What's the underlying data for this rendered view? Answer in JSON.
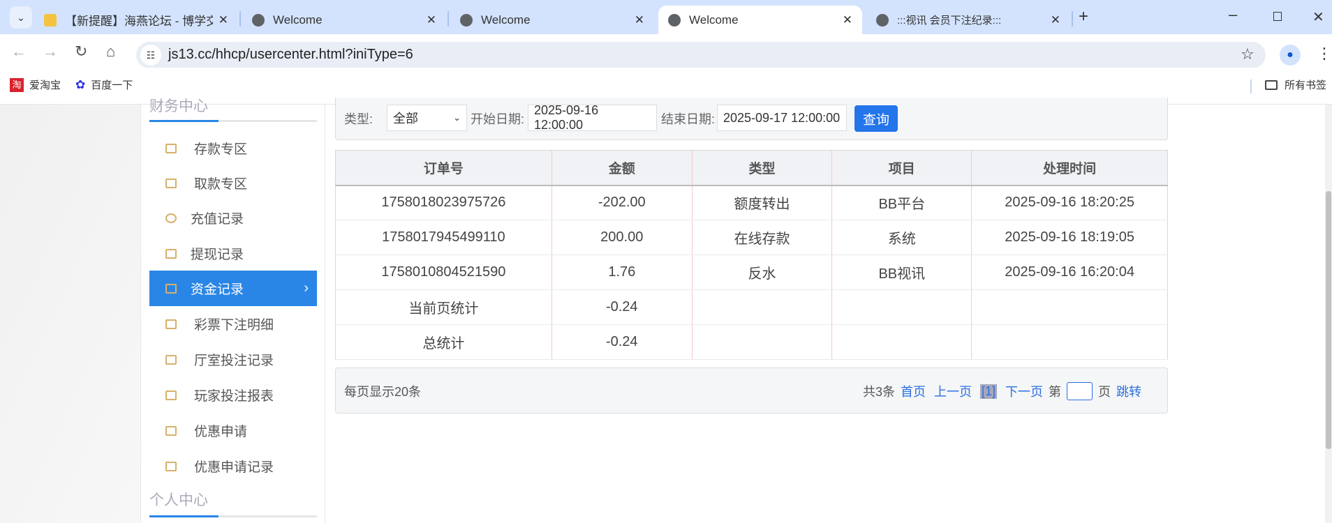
{
  "browser": {
    "tabs": [
      {
        "title": "【新提醒】海燕论坛 - 博学交流",
        "active": false
      },
      {
        "title": "Welcome",
        "active": false
      },
      {
        "title": "Welcome",
        "active": false
      },
      {
        "title": "Welcome",
        "active": true
      },
      {
        "title": ":::视讯 会员下注纪录:::",
        "active": false
      }
    ],
    "url": "js13.cc/hhcp/usercenter.html?iniType=6",
    "bookmarks": [
      "爱淘宝",
      "百度一下"
    ],
    "all_bookmarks": "所有书签"
  },
  "sidebar": {
    "section1": "财务中心",
    "items": [
      {
        "label": "存款专区",
        "icon": "card-icon"
      },
      {
        "label": "取款专区",
        "icon": "hand-money-icon"
      },
      {
        "label": "充值记录",
        "icon": "money-bag-icon"
      },
      {
        "label": "提现记录",
        "icon": "wallet-icon"
      },
      {
        "label": "资金记录",
        "icon": "safe-icon",
        "active": true
      },
      {
        "label": "彩票下注明细",
        "icon": "list-icon"
      },
      {
        "label": "厅室投注记录",
        "icon": "list-icon"
      },
      {
        "label": "玩家投注报表",
        "icon": "chart-icon"
      },
      {
        "label": "优惠申请",
        "icon": "gift-icon"
      },
      {
        "label": "优惠申请记录",
        "icon": "list-icon"
      }
    ],
    "section2": "个人中心"
  },
  "filter": {
    "type_label": "类型:",
    "type_value": "全部",
    "start_label": "开始日期:",
    "start_value": "2025-09-16 12:00:00",
    "end_label": "结束日期:",
    "end_value": "2025-09-17 12:00:00",
    "query_button": "查询"
  },
  "table": {
    "headers": [
      "订单号",
      "金额",
      "类型",
      "项目",
      "处理时间"
    ],
    "rows": [
      [
        "1758018023975726",
        "-202.00",
        "额度转出",
        "BB平台",
        "2025-09-16 18:20:25"
      ],
      [
        "1758017945499110",
        "200.00",
        "在线存款",
        "系统",
        "2025-09-16 18:19:05"
      ],
      [
        "1758010804521590",
        "1.76",
        "反水",
        "BB视讯",
        "2025-09-16 16:20:04"
      ],
      [
        "当前页统计",
        "-0.24",
        "",
        "",
        ""
      ],
      [
        "总统计",
        "-0.24",
        "",
        "",
        ""
      ]
    ]
  },
  "pager": {
    "per_page": "每页显示20条",
    "total": "共3条",
    "first": "首页",
    "prev": "上一页",
    "current": "[1]",
    "next": "下一页",
    "goto_prefix": "第",
    "goto_suffix": "页",
    "jump": "跳转"
  },
  "colors": {
    "accent": "#2a86e6",
    "button": "#2474ea",
    "tabstrip": "#d3e3fd"
  }
}
